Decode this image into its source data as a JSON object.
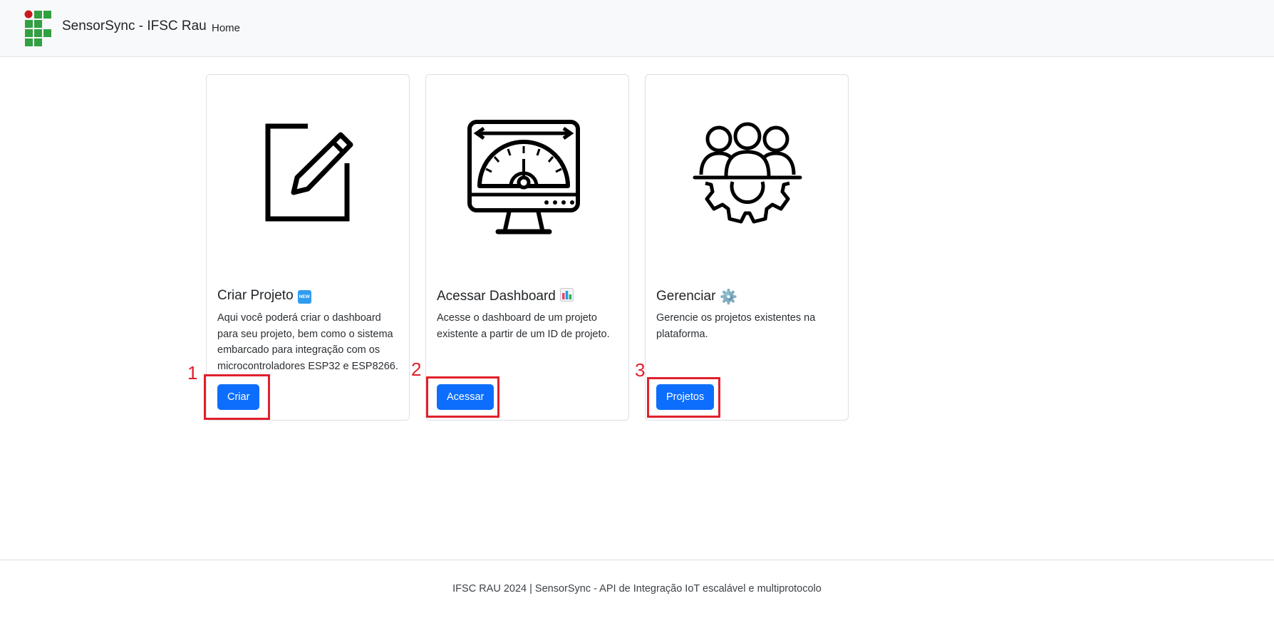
{
  "navbar": {
    "brand": "SensorSync - IFSC Rau",
    "home_link": "Home",
    "logo_icon": "ifsc-logo-icon"
  },
  "cards": [
    {
      "title": "Criar Projeto",
      "title_emoji": "NEW",
      "text": "Aqui você poderá criar o dashboard para seu projeto, bem como o sistema embarcado para integração com os microcontroladores ESP32 e ESP8266.",
      "button": "Criar",
      "marker": "1",
      "icon": "edit-icon"
    },
    {
      "title": "Acessar Dashboard",
      "title_emoji": "bar-chart-icon",
      "text": "Acesse o dashboard de um projeto existente a partir de um ID de projeto.",
      "button": "Acessar",
      "marker": "2",
      "icon": "dashboard-gauge-icon"
    },
    {
      "title": "Gerenciar",
      "title_emoji": "⚙️",
      "text": "Gerencie os projetos existentes na plataforma.",
      "button": "Projetos",
      "marker": "3",
      "icon": "team-gear-icon"
    }
  ],
  "footer": {
    "text": "IFSC RAU 2024 | SensorSync - API de Integração IoT escalável e multiprotocolo"
  },
  "colors": {
    "primary": "#0d6efd",
    "annotation": "#e0202b",
    "logo_green": "#32a041",
    "logo_red": "#c8191e"
  }
}
